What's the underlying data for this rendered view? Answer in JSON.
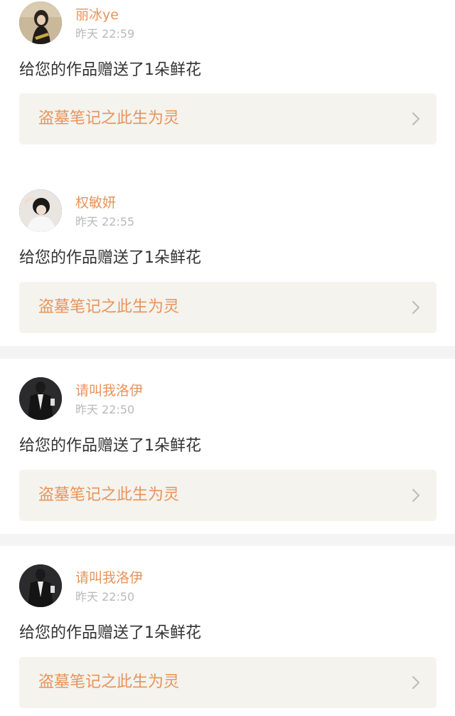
{
  "notifications": [
    {
      "user_name": "丽冰ye",
      "timestamp": "昨天 22:59",
      "message": "给您的作品赠送了1朵鲜花",
      "work_title": "盗墓笔记之此生为灵",
      "avatar": "avatar-girl-dark-hair"
    },
    {
      "user_name": "权敏妍",
      "timestamp": "昨天 22:55",
      "message": "给您的作品赠送了1朵鲜花",
      "work_title": "盗墓笔记之此生为灵",
      "avatar": "avatar-girl-white"
    },
    {
      "user_name": "请叫我洛伊",
      "timestamp": "昨天 22:50",
      "message": "给您的作品赠送了1朵鲜花",
      "work_title": "盗墓笔记之此生为灵",
      "avatar": "avatar-man-suit"
    },
    {
      "user_name": "请叫我洛伊",
      "timestamp": "昨天 22:50",
      "message": "给您的作品赠送了1朵鲜花",
      "work_title": "盗墓笔记之此生为灵",
      "avatar": "avatar-man-suit"
    }
  ],
  "colors": {
    "accent": "#e8935a",
    "timestamp": "#b9b9b9",
    "text": "#333333",
    "link_background": "#f4f3ee",
    "page_background": "#f4f4f4"
  },
  "icons": {
    "chevron": "chevron-right-icon"
  }
}
